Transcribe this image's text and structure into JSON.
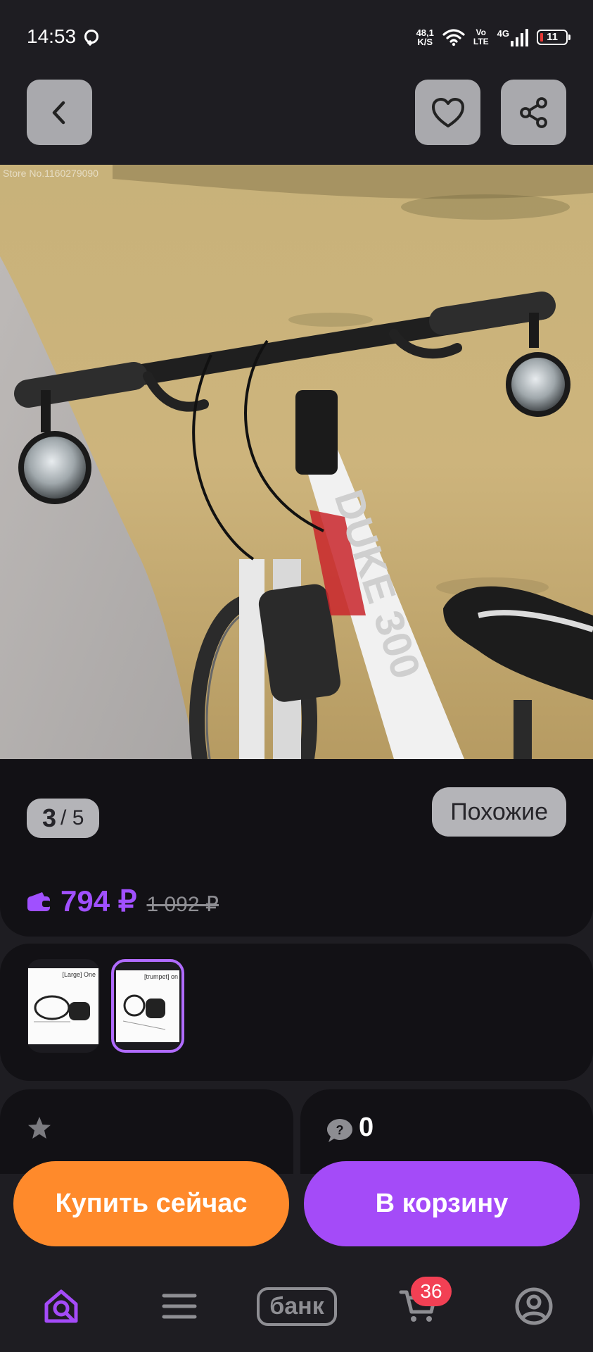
{
  "status_bar": {
    "time": "14:53",
    "net_speed_value": "48,1",
    "net_speed_unit": "K/S",
    "volte_top": "Vo",
    "volte_bottom": "LTE",
    "network_type": "4G",
    "battery": "11"
  },
  "hero": {
    "watermark": "Store No.1160279090",
    "bike_label": "DUKE 300"
  },
  "gallery": {
    "current": "3",
    "total_sep": "/ 5",
    "similar_label": "Похожие"
  },
  "price": {
    "current": "794 ₽",
    "old": "1 092 ₽"
  },
  "variants": [
    {
      "caption": "[Large] One"
    },
    {
      "caption": "[trumpet] on"
    }
  ],
  "stats": {
    "questions_count": "0"
  },
  "actions": {
    "buy_now": "Купить сейчас",
    "add_to_cart": "В корзину"
  },
  "nav": {
    "bank_label": "банк",
    "cart_badge": "36"
  },
  "colors": {
    "accent_purple": "#a44bf8",
    "price_purple": "#a050ff",
    "buy_orange": "#ff8a2b",
    "badge_red": "#f24054"
  }
}
